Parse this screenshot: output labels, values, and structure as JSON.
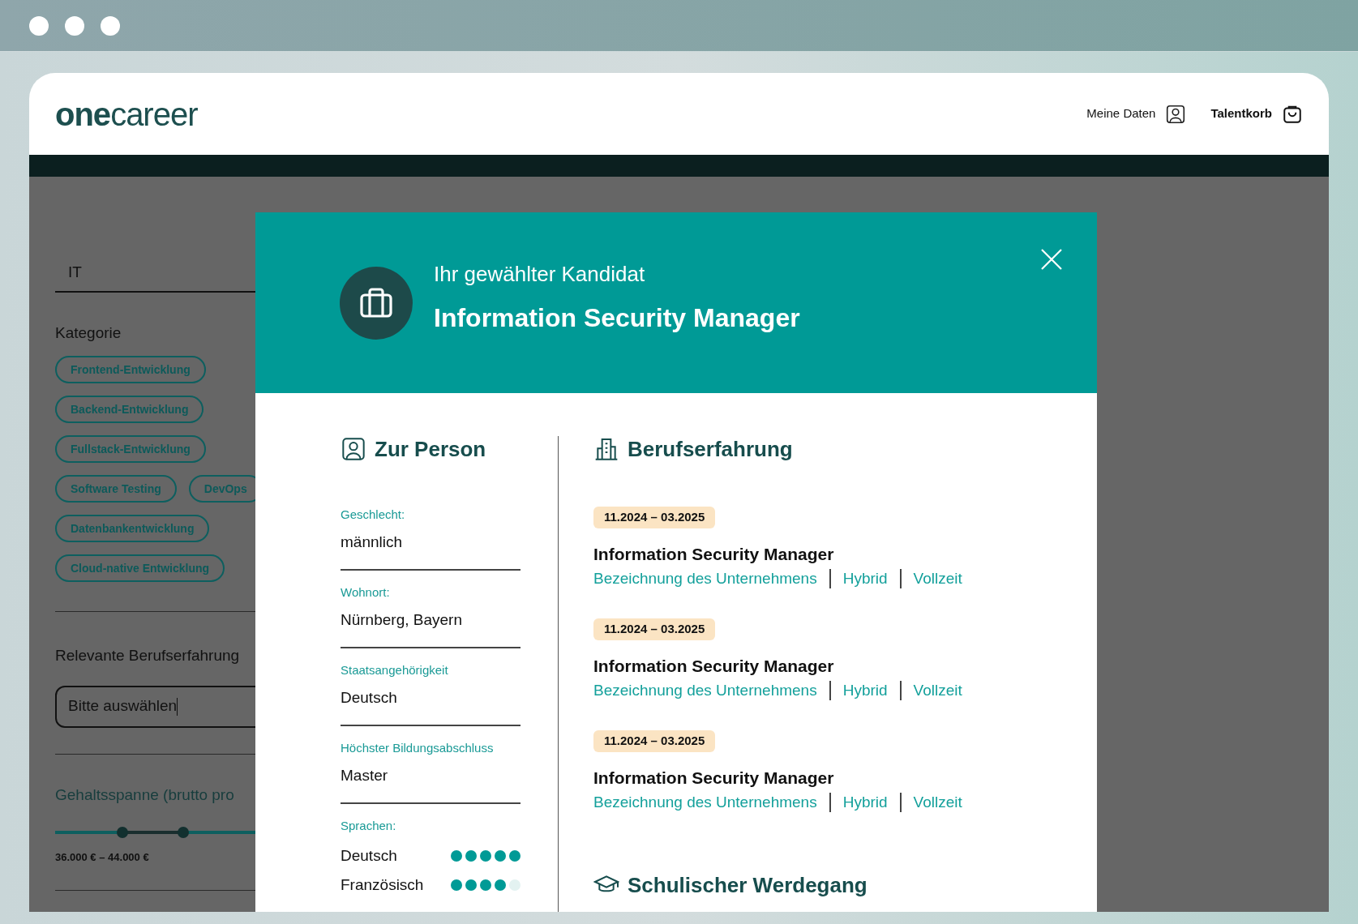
{
  "header": {
    "logo": {
      "bold": "one",
      "light": "career"
    },
    "nav": [
      {
        "label": "Meine Daten",
        "kind": "account"
      },
      {
        "label": "Talentkorb",
        "kind": "basket"
      }
    ]
  },
  "filters": {
    "search_value": "IT",
    "category": {
      "title": "Kategorie",
      "chips": [
        [
          "Frontend-Entwicklung"
        ],
        [
          "Backend-Entwicklung"
        ],
        [
          "Fullstack-Entwicklung"
        ],
        [
          "Software Testing",
          "DevOps"
        ],
        [
          "Datenbankentwicklung"
        ],
        [
          "Cloud-native Entwicklung"
        ]
      ]
    },
    "experience": {
      "title": "Relevante Berufserfahrung",
      "value": "Bitte auswählen"
    },
    "salary": {
      "title": "Gehaltsspanne (brutto pro",
      "low": {
        "level": 0.33
      },
      "high": {
        "level": 0.63
      },
      "reading": "36.000 € – 44.000 €"
    }
  },
  "modal": {
    "subtitle": "Ihr gewählter Kandidat",
    "title": "Information Security Manager",
    "person": {
      "heading": "Zur Person",
      "fields": [
        {
          "label": "Geschlecht:",
          "value": "männlich"
        },
        {
          "label": "Wohnort:",
          "value": "Nürnberg, Bayern"
        },
        {
          "label": "Staatsangehörigkeit",
          "value": "Deutsch"
        },
        {
          "label": "Höchster Bildungsabschluss",
          "value": "Master"
        }
      ],
      "languages": {
        "label": "Sprachen:",
        "items": [
          {
            "name": "Deutsch",
            "stars": 5
          },
          {
            "name": "Französisch",
            "stars": 4
          }
        ]
      }
    },
    "experience": {
      "heading": "Berufserfahrung",
      "entries": [
        {
          "period": "11.2024 – 03.2025",
          "title": "Information Security Manager",
          "meta": [
            "Bezeichnung des Unternehmens",
            "Hybrid",
            "Vollzeit"
          ]
        },
        {
          "period": "11.2024 – 03.2025",
          "title": "Information Security Manager",
          "meta": [
            "Bezeichnung des Unternehmens",
            "Hybrid",
            "Vollzeit"
          ]
        },
        {
          "period": "11.2024 – 03.2025",
          "title": "Information Security Manager",
          "meta": [
            "Bezeichnung des Unternehmens",
            "Hybrid",
            "Vollzeit"
          ]
        }
      ]
    },
    "education": {
      "heading": "Schulischer Werdegang"
    }
  }
}
